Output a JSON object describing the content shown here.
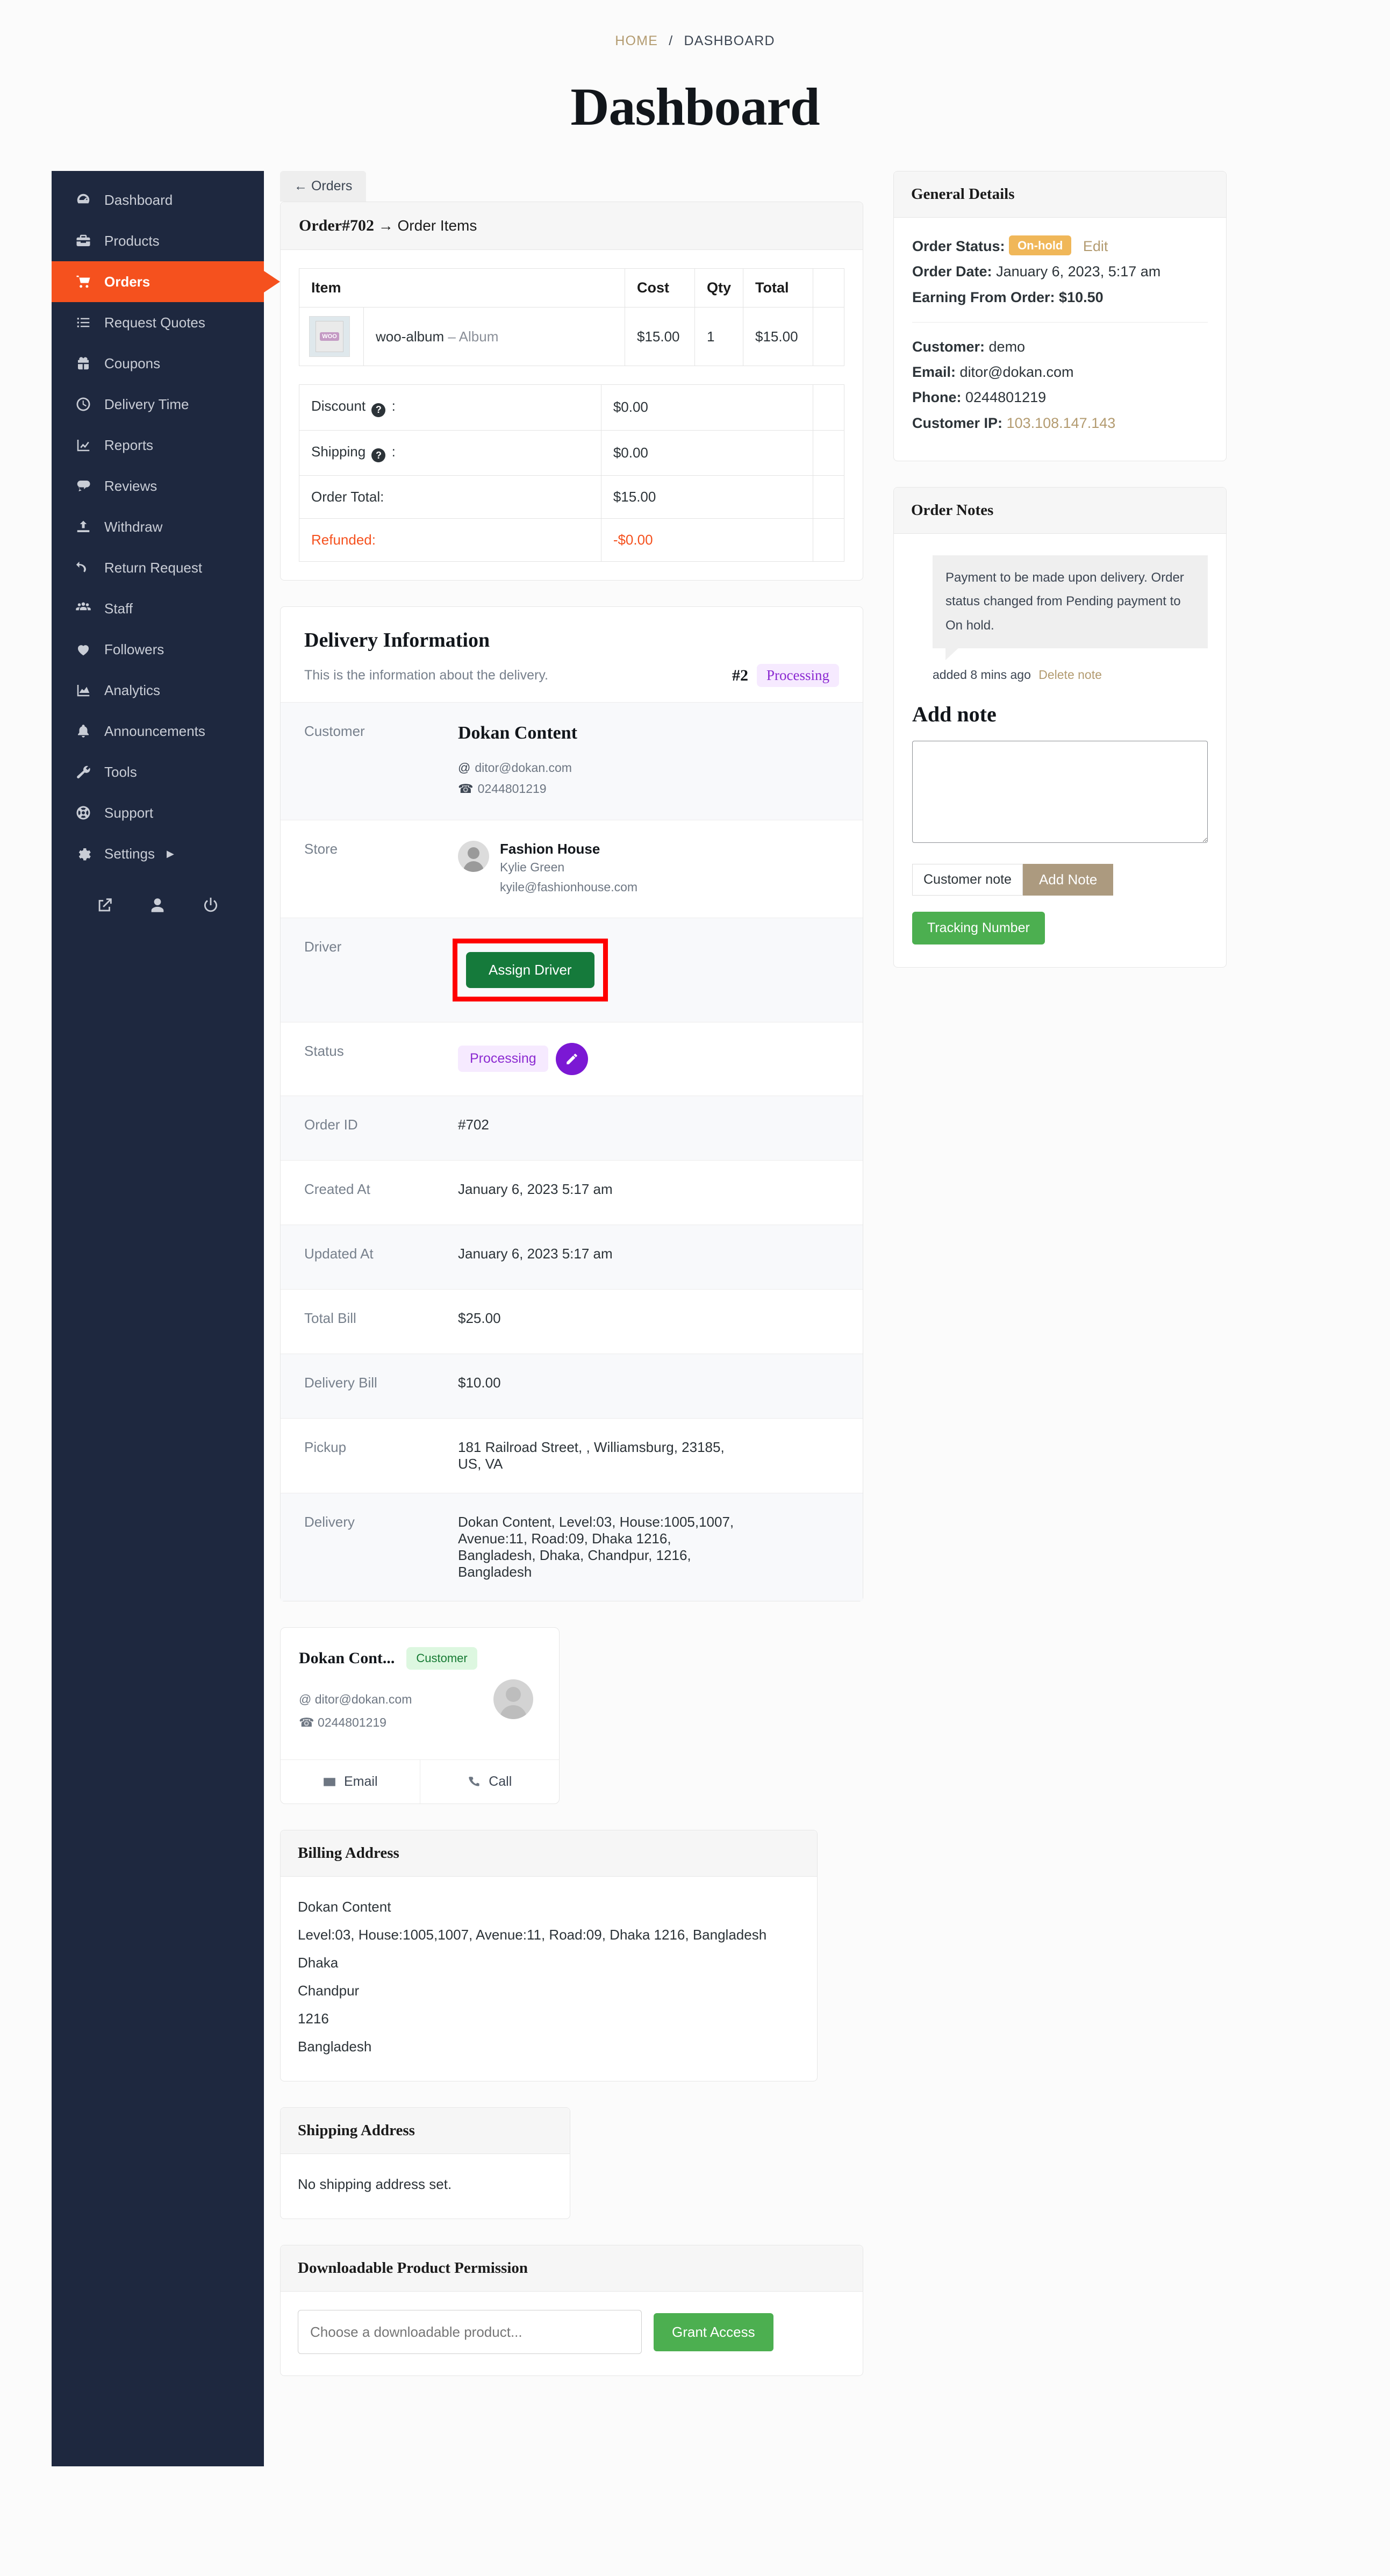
{
  "breadcrumb": {
    "home": "HOME",
    "separator": "/",
    "current": "DASHBOARD"
  },
  "page_title": "Dashboard",
  "colors": {
    "sidebar_bg": "#1e283f",
    "active_nav": "#f5511e",
    "accent_gold": "#b39b70",
    "green_button": "#157a3b",
    "highlight_red": "#ff0000",
    "processing_purple": "#8b2ad1",
    "onhold_amber": "#f0b759"
  },
  "sidebar": {
    "items": [
      {
        "label": "Dashboard",
        "icon": "gauge-icon",
        "active": false
      },
      {
        "label": "Products",
        "icon": "toolbox-icon",
        "active": false
      },
      {
        "label": "Orders",
        "icon": "cart-icon",
        "active": true
      },
      {
        "label": "Request Quotes",
        "icon": "list-icon",
        "active": false
      },
      {
        "label": "Coupons",
        "icon": "gift-icon",
        "active": false
      },
      {
        "label": "Delivery Time",
        "icon": "clock-icon",
        "active": false
      },
      {
        "label": "Reports",
        "icon": "chart-line-icon",
        "active": false
      },
      {
        "label": "Reviews",
        "icon": "comment-icon",
        "active": false
      },
      {
        "label": "Withdraw",
        "icon": "upload-icon",
        "active": false
      },
      {
        "label": "Return Request",
        "icon": "undo-icon",
        "active": false
      },
      {
        "label": "Staff",
        "icon": "users-icon",
        "active": false
      },
      {
        "label": "Followers",
        "icon": "heart-icon",
        "active": false
      },
      {
        "label": "Analytics",
        "icon": "area-chart-icon",
        "active": false
      },
      {
        "label": "Announcements",
        "icon": "bell-icon",
        "active": false
      },
      {
        "label": "Tools",
        "icon": "wrench-icon",
        "active": false
      },
      {
        "label": "Support",
        "icon": "lifebuoy-icon",
        "active": false
      },
      {
        "label": "Settings",
        "icon": "gear-icon",
        "active": false,
        "caret": "▶"
      }
    ],
    "footer_icons": [
      "external-link-icon",
      "user-icon",
      "power-icon"
    ]
  },
  "back_button": {
    "label": "← Orders"
  },
  "order_items_card": {
    "title_order": "Order#702",
    "title_rest": " → Order Items",
    "columns": [
      "Item",
      "",
      "Cost",
      "Qty",
      "Total",
      ""
    ],
    "rows": [
      {
        "thumb_label": "WOO",
        "name": "woo-album",
        "dash": " – ",
        "variant": "Album",
        "cost": "$15.00",
        "qty": "1",
        "total": "$15.00"
      }
    ],
    "totals": [
      {
        "label": "Discount",
        "tooltip": "?",
        "suffix": " :",
        "value": "$0.00",
        "refund": false
      },
      {
        "label": "Shipping",
        "tooltip": "?",
        "suffix": " :",
        "value": "$0.00",
        "refund": false
      },
      {
        "label": "Order Total:",
        "tooltip": "",
        "suffix": "",
        "value": "$15.00",
        "refund": false
      },
      {
        "label": "Refunded:",
        "tooltip": "",
        "suffix": "",
        "value": "-$0.00",
        "refund": true
      }
    ]
  },
  "delivery_information": {
    "title": "Delivery Information",
    "subtitle": "This is the information about the delivery.",
    "number": "#2",
    "status_badge": "Processing",
    "rows": {
      "customer_label": "Customer",
      "customer_name": "Dokan Content",
      "customer_email": "ditor@dokan.com",
      "customer_phone": "0244801219",
      "store_label": "Store",
      "store_name": "Fashion House",
      "store_owner": "Kylie Green",
      "store_email": "kyile@fashionhouse.com",
      "driver_label": "Driver",
      "assign_driver_button": "Assign Driver",
      "status_label": "Status",
      "status_value": "Processing",
      "order_id_label": "Order ID",
      "order_id_value": "#702",
      "created_at_label": "Created At",
      "created_at_value": "January 6, 2023 5:17 am",
      "updated_at_label": "Updated At",
      "updated_at_value": "January 6, 2023 5:17 am",
      "total_bill_label": "Total Bill",
      "total_bill_value": "$25.00",
      "delivery_bill_label": "Delivery Bill",
      "delivery_bill_value": "$10.00",
      "pickup_label": "Pickup",
      "pickup_value": "181 Railroad Street, , Williamsburg, 23185, US, VA",
      "delivery_label": "Delivery",
      "delivery_value": "Dokan Content, Level:03, House:1005,1007, Avenue:11, Road:09, Dhaka 1216, Bangladesh, Dhaka, Chandpur, 1216, Bangladesh"
    }
  },
  "customer_card": {
    "name": "Dokan Cont...",
    "badge": "Customer",
    "email": "ditor@dokan.com",
    "phone": "0244801219",
    "email_action": "Email",
    "call_action": "Call"
  },
  "billing_address": {
    "title": "Billing Address",
    "lines": [
      "Dokan Content",
      "Level:03, House:1005,1007, Avenue:11, Road:09, Dhaka 1216, Bangladesh",
      "Dhaka",
      "Chandpur",
      "1216",
      "Bangladesh"
    ]
  },
  "shipping_address": {
    "title": "Shipping Address",
    "empty_text": "No shipping address set."
  },
  "downloadable": {
    "title": "Downloadable Product Permission",
    "input_placeholder": "Choose a downloadable product...",
    "grant_button": "Grant Access"
  },
  "general_details": {
    "title": "General Details",
    "order_status_label": "Order Status:",
    "order_status_value": "On-hold",
    "edit_link": "Edit",
    "order_date_label": "Order Date:",
    "order_date_value": "January 6, 2023, 5:17 am",
    "earning_label": "Earning From Order:",
    "earning_value": "$10.50",
    "customer_label": "Customer:",
    "customer_value": "demo",
    "email_label": "Email:",
    "email_value": "ditor@dokan.com",
    "phone_label": "Phone:",
    "phone_value": "0244801219",
    "ip_label": "Customer IP:",
    "ip_value": "103.108.147.143"
  },
  "order_notes": {
    "title": "Order Notes",
    "note_text": "Payment to be made upon delivery. Order status changed from Pending payment to On hold.",
    "note_added": "added 8 mins ago",
    "delete_link": "Delete note",
    "add_note_title": "Add note",
    "textarea_value": "",
    "note_type_selected": "Customer note",
    "add_note_button": "Add Note",
    "tracking_button": "Tracking Number"
  }
}
